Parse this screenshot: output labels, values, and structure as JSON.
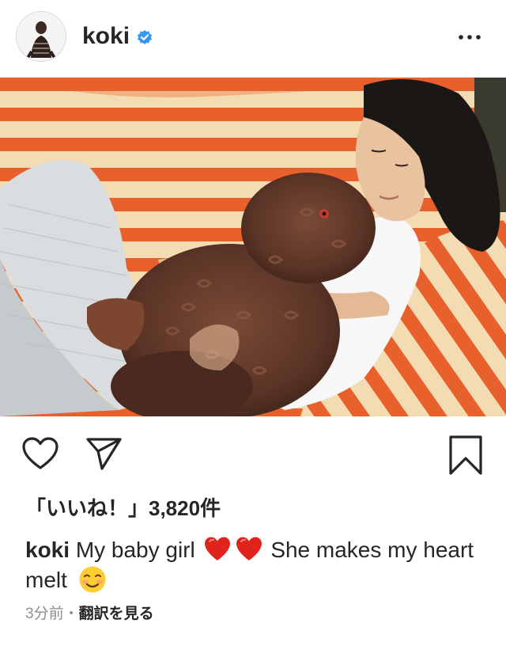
{
  "post": {
    "username": "koki",
    "verified": true,
    "more_icon": "more-horizontal-icon",
    "likes_text": "「いいね！」3,820件",
    "caption": {
      "username": "koki",
      "text_part1": "My baby girl",
      "text_part2": "She makes my heart melt",
      "emoji": [
        "red-heart",
        "red-heart",
        "smiling-face"
      ]
    },
    "timestamp": "3分前",
    "separator": "・",
    "translate_label": "翻訳を見る"
  },
  "icons": {
    "like": "heart-outline-icon",
    "share": "paper-plane-icon",
    "save": "bookmark-outline-icon"
  },
  "colors": {
    "text": "#262626",
    "muted": "#8e8e8e",
    "verified": "#3897f0",
    "heart": "#e0241b"
  }
}
